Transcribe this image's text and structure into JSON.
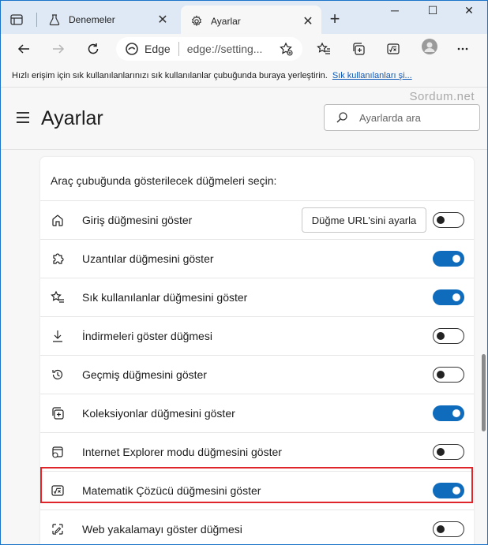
{
  "tabs": [
    {
      "title": "Denemeler",
      "icon": "beaker-icon",
      "active": false
    },
    {
      "title": "Ayarlar",
      "icon": "gear-icon",
      "active": true
    }
  ],
  "window_controls": {
    "minimize": "─",
    "maximize": "☐",
    "close": "✕"
  },
  "tab_close_glyph": "✕",
  "new_tab_glyph": "+",
  "address": {
    "site": "Edge",
    "url": "edge://setting..."
  },
  "favorites_bar": {
    "prompt": "Hızlı erişim için sık kullanılanlarınızı sık kullanılanlar çubuğunda buraya yerleştirin.",
    "link": "Sık kullanılanları şi..."
  },
  "header": {
    "watermark": "Sordum.net",
    "title": "Ayarlar",
    "search_placeholder": "Ayarlarda ara"
  },
  "card": {
    "heading": "Araç çubuğunda gösterilecek düğmeleri seçin:",
    "rows": [
      {
        "label": "Giriş düğmesini göster",
        "icon": "home-icon",
        "button": "Düğme URL'sini ayarla",
        "enabled": false
      },
      {
        "label": "Uzantılar düğmesini göster",
        "icon": "puzzle-icon",
        "enabled": true
      },
      {
        "label": "Sık kullanılanlar düğmesini göster",
        "icon": "star-list-icon",
        "enabled": true
      },
      {
        "label": "İndirmeleri göster düğmesi",
        "icon": "download-icon",
        "enabled": false
      },
      {
        "label": "Geçmiş düğmesini göster",
        "icon": "history-icon",
        "enabled": false
      },
      {
        "label": "Koleksiyonlar düğmesini göster",
        "icon": "collections-icon",
        "enabled": true
      },
      {
        "label": "Internet Explorer modu düğmesini göster",
        "icon": "ie-mode-icon",
        "enabled": false
      },
      {
        "label": "Matematik Çözücü düğmesini göster",
        "icon": "math-solver-icon",
        "enabled": true
      },
      {
        "label": "Web yakalamayı göster düğmesi",
        "icon": "web-capture-icon",
        "enabled": false
      }
    ]
  },
  "colors": {
    "accent": "#0f6cbd",
    "highlight": "#e0252a",
    "link": "#0c58b8"
  }
}
